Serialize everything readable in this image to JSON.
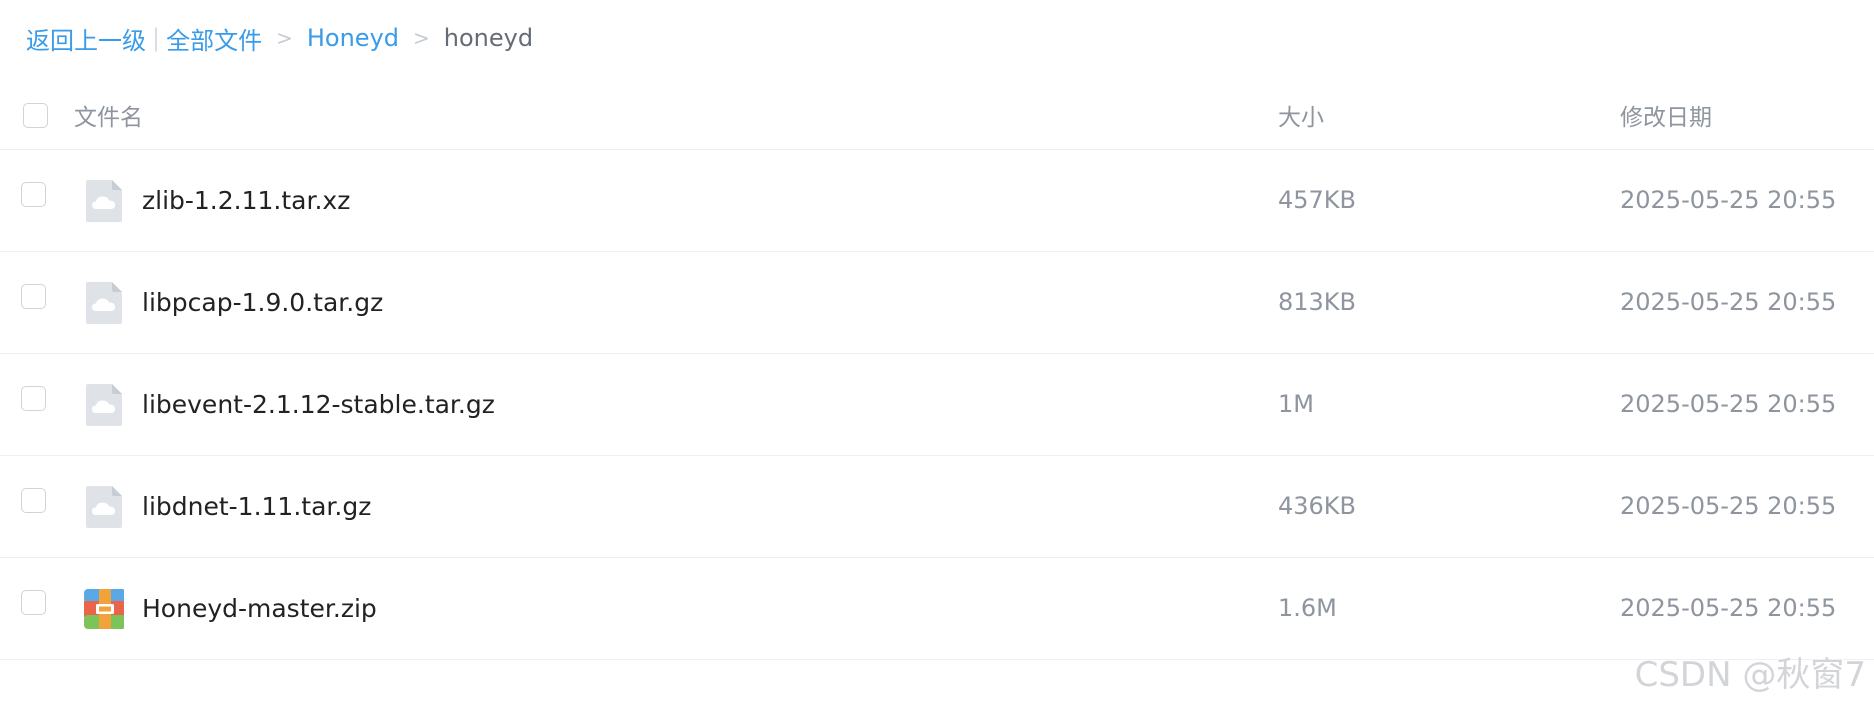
{
  "breadcrumb": {
    "back": "返回上一级",
    "divider": "|",
    "all_files": "全部文件",
    "separator": ">",
    "level1": "Honeyd",
    "current": "honeyd"
  },
  "table": {
    "columns": {
      "name": "文件名",
      "size": "大小",
      "date": "修改日期"
    },
    "rows": [
      {
        "name": "zlib-1.2.11.tar.xz",
        "size": "457KB",
        "date": "2025-05-25 20:55",
        "icon": "cloud-file-icon"
      },
      {
        "name": "libpcap-1.9.0.tar.gz",
        "size": "813KB",
        "date": "2025-05-25 20:55",
        "icon": "cloud-file-icon"
      },
      {
        "name": "libevent-2.1.12-stable.tar.gz",
        "size": "1M",
        "date": "2025-05-25 20:55",
        "icon": "cloud-file-icon"
      },
      {
        "name": "libdnet-1.11.tar.gz",
        "size": "436KB",
        "date": "2025-05-25 20:55",
        "icon": "cloud-file-icon"
      },
      {
        "name": "Honeyd-master.zip",
        "size": "1.6M",
        "date": "2025-05-25 20:55",
        "icon": "zip-archive-icon"
      }
    ]
  },
  "watermark": "CSDN @秋窗7",
  "colors": {
    "link": "#3a9be8",
    "muted": "#8e959e",
    "border": "#eef0f3"
  }
}
